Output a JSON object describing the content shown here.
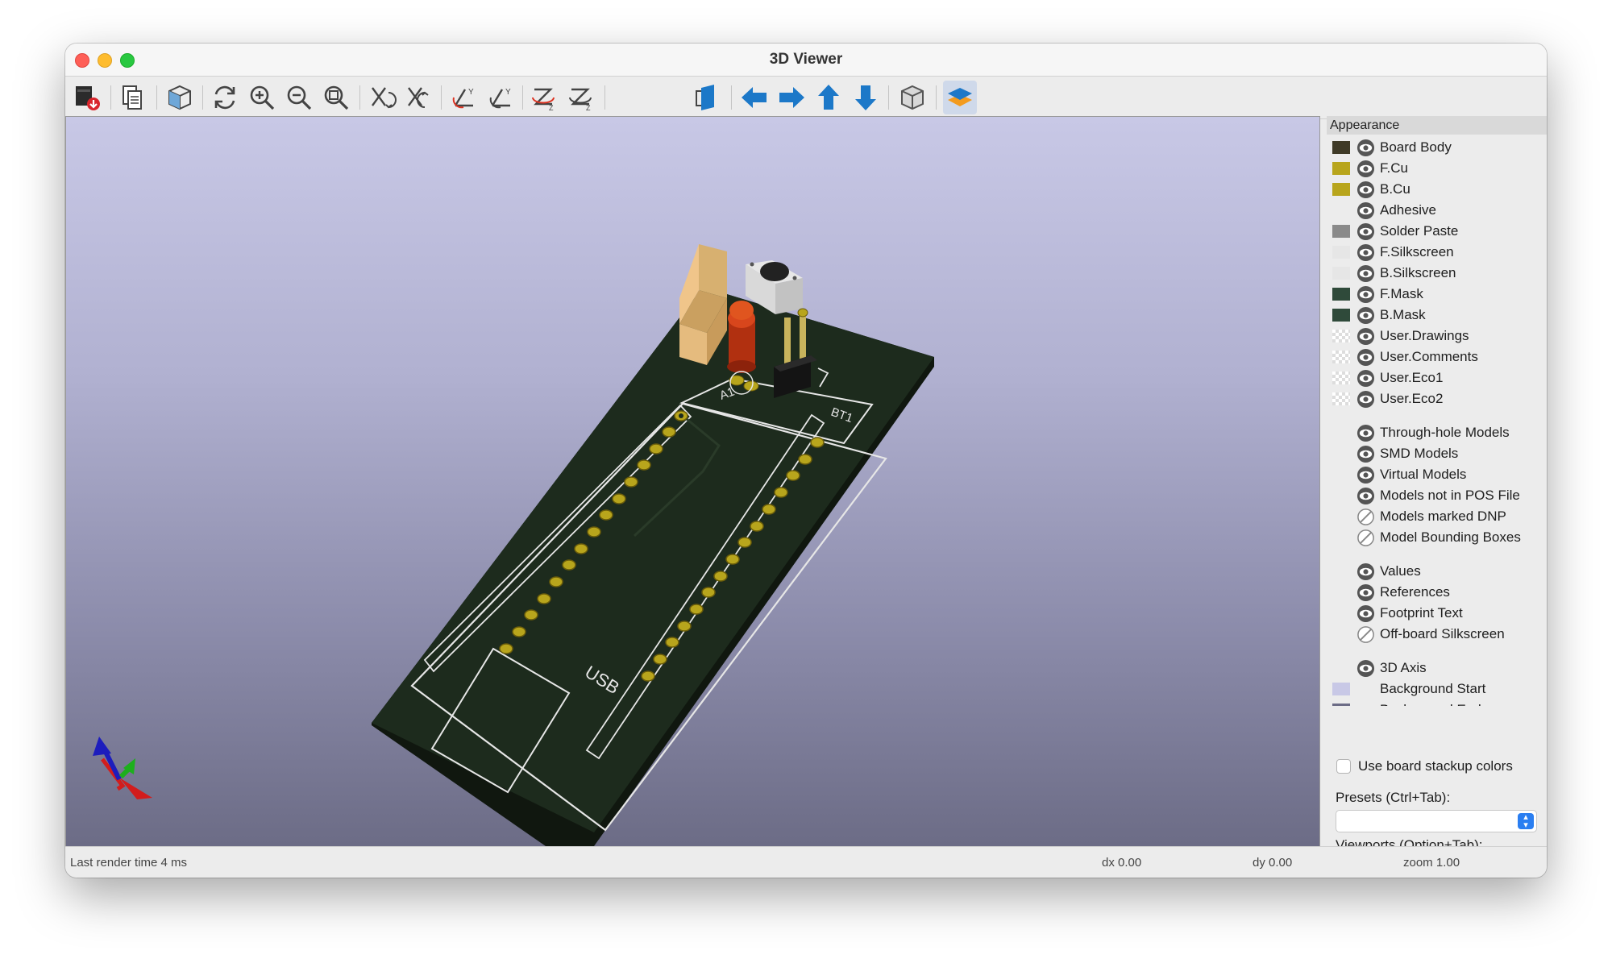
{
  "window": {
    "title": "3D Viewer"
  },
  "toolbar": {
    "buttons": [
      {
        "name": "export-image",
        "icon": "export-image-icon"
      },
      {
        "name": "copy-clipboard",
        "icon": "copy-clipboard-icon"
      },
      {
        "name": "reload-board",
        "icon": "reload-board-icon"
      },
      {
        "name": "redraw",
        "icon": "redraw-icon"
      },
      {
        "name": "zoom-in",
        "icon": "zoom-in-icon"
      },
      {
        "name": "zoom-out",
        "icon": "zoom-out-icon"
      },
      {
        "name": "zoom-fit",
        "icon": "zoom-fit-icon"
      },
      {
        "name": "rotate-x-cw",
        "icon": "rotate-x-cw-icon"
      },
      {
        "name": "rotate-x-ccw",
        "icon": "rotate-x-ccw-icon"
      },
      {
        "name": "rotate-y-cw",
        "icon": "rotate-y-cw-icon"
      },
      {
        "name": "rotate-y-ccw",
        "icon": "rotate-y-ccw-icon"
      },
      {
        "name": "rotate-z-cw",
        "icon": "rotate-z-cw-icon"
      },
      {
        "name": "rotate-z-ccw",
        "icon": "rotate-z-ccw-icon"
      },
      {
        "name": "flip-board",
        "icon": "flip-board-icon"
      },
      {
        "name": "move-left",
        "icon": "arrow-left-icon"
      },
      {
        "name": "move-right",
        "icon": "arrow-right-icon"
      },
      {
        "name": "move-up",
        "icon": "arrow-up-icon"
      },
      {
        "name": "move-down",
        "icon": "arrow-down-icon"
      },
      {
        "name": "ortho-view",
        "icon": "ortho-cube-icon"
      },
      {
        "name": "toggle-appearance",
        "icon": "layers-icon"
      }
    ]
  },
  "viewport": {
    "silk": {
      "usb": "USB",
      "a1": "A1",
      "bt1": "BT1"
    }
  },
  "appearance": {
    "header": "Appearance",
    "layers": [
      {
        "label": "Board Body",
        "color": "#3f3a27",
        "visible": true
      },
      {
        "label": "F.Cu",
        "color": "#b8a51c",
        "visible": true
      },
      {
        "label": "B.Cu",
        "color": "#b8a51c",
        "visible": true
      },
      {
        "label": "Adhesive",
        "color": null,
        "visible": true
      },
      {
        "label": "Solder Paste",
        "color": "#8a8a8a",
        "visible": true
      },
      {
        "label": "F.Silkscreen",
        "color": "#e6e6e6",
        "visible": true
      },
      {
        "label": "B.Silkscreen",
        "color": "#e6e6e6",
        "visible": true
      },
      {
        "label": "F.Mask",
        "color": "#2f4a3a",
        "visible": true
      },
      {
        "label": "B.Mask",
        "color": "#2f4a3a",
        "visible": true
      },
      {
        "label": "User.Drawings",
        "color": "checker",
        "visible": true
      },
      {
        "label": "User.Comments",
        "color": "checker",
        "visible": true
      },
      {
        "label": "User.Eco1",
        "color": "checker",
        "visible": true
      },
      {
        "label": "User.Eco2",
        "color": "checker",
        "visible": true
      },
      {
        "label": "Through-hole Models",
        "color": null,
        "visible": true
      },
      {
        "label": "SMD Models",
        "color": null,
        "visible": true
      },
      {
        "label": "Virtual Models",
        "color": null,
        "visible": true
      },
      {
        "label": "Models not in POS File",
        "color": null,
        "visible": true
      },
      {
        "label": "Models marked DNP",
        "color": null,
        "visible": false
      },
      {
        "label": "Model Bounding Boxes",
        "color": null,
        "visible": false
      },
      {
        "label": "Values",
        "color": null,
        "visible": true
      },
      {
        "label": "References",
        "color": null,
        "visible": true
      },
      {
        "label": "Footprint Text",
        "color": null,
        "visible": true
      },
      {
        "label": "Off-board Silkscreen",
        "color": null,
        "visible": false
      },
      {
        "label": "3D Axis",
        "color": null,
        "visible": true
      },
      {
        "label": "Background Start",
        "color": "#c8c8e6",
        "visible": null
      },
      {
        "label": "Background End",
        "color": "#6c6c86",
        "visible": null
      }
    ],
    "use_stackup_label": "Use board stackup colors",
    "use_stackup_checked": false,
    "presets_label": "Presets (Ctrl+Tab):",
    "presets_value": "",
    "viewports_label": "Viewports (Option+Tab):",
    "viewports_value": ""
  },
  "status": {
    "render_time": "Last render time 4 ms",
    "dx": "dx 0.00",
    "dy": "dy 0.00",
    "zoom": "zoom 1.00"
  }
}
